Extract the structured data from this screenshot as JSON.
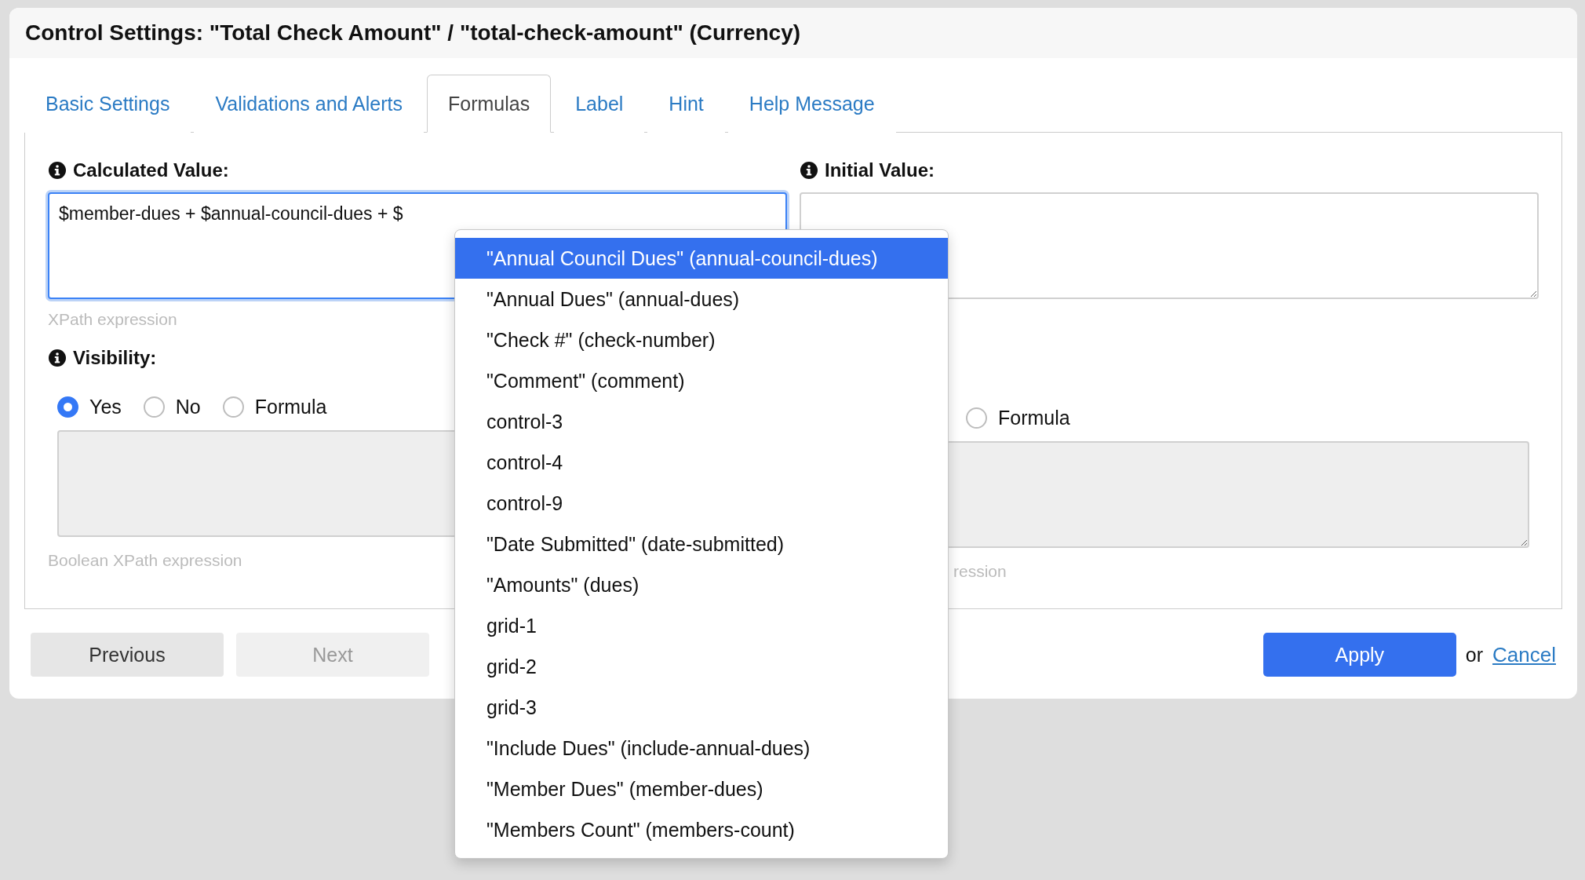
{
  "dialog": {
    "title": "Control Settings: \"Total Check Amount\" / \"total-check-amount\" (Currency)"
  },
  "tabs": [
    {
      "label": "Basic Settings",
      "selected": false
    },
    {
      "label": "Validations and Alerts",
      "selected": false
    },
    {
      "label": "Formulas",
      "selected": true
    },
    {
      "label": "Label",
      "selected": false
    },
    {
      "label": "Hint",
      "selected": false
    },
    {
      "label": "Help Message",
      "selected": false
    }
  ],
  "calculated_value": {
    "label": "Calculated Value:",
    "value": "$member-dues + $annual-council-dues + $",
    "focused": true,
    "hint": "XPath expression"
  },
  "initial_value": {
    "label": "Initial Value:",
    "focused": false
  },
  "visibility": {
    "label": "Visibility:",
    "options": [
      {
        "label": "Yes",
        "selected": true
      },
      {
        "label": "No",
        "selected": false
      },
      {
        "label": "Formula",
        "selected": false
      }
    ],
    "hint": "Boolean XPath expression"
  },
  "second_condition": {
    "options": [
      {
        "label": "Formula",
        "selected": false
      }
    ],
    "hint": "ression"
  },
  "autocomplete": {
    "items": [
      {
        "label": "\"Annual Council Dues\" (annual-council-dues)",
        "selected": true
      },
      {
        "label": "\"Annual Dues\" (annual-dues)",
        "selected": false
      },
      {
        "label": "\"Check #\" (check-number)",
        "selected": false
      },
      {
        "label": "\"Comment\" (comment)",
        "selected": false
      },
      {
        "label": "control-3",
        "selected": false
      },
      {
        "label": "control-4",
        "selected": false
      },
      {
        "label": "control-9",
        "selected": false
      },
      {
        "label": "\"Date Submitted\" (date-submitted)",
        "selected": false
      },
      {
        "label": "\"Amounts\" (dues)",
        "selected": false
      },
      {
        "label": "grid-1",
        "selected": false
      },
      {
        "label": "grid-2",
        "selected": false
      },
      {
        "label": "grid-3",
        "selected": false
      },
      {
        "label": "\"Include Dues\" (include-annual-dues)",
        "selected": false
      },
      {
        "label": "\"Member Dues\" (member-dues)",
        "selected": false
      },
      {
        "label": "\"Members Count\" (members-count)",
        "selected": false
      }
    ]
  },
  "buttons": {
    "previous": {
      "label": "Previous",
      "disabled": false
    },
    "next": {
      "label": "Next",
      "disabled": true
    },
    "apply": "Apply",
    "or": "or",
    "cancel": "Cancel"
  }
}
